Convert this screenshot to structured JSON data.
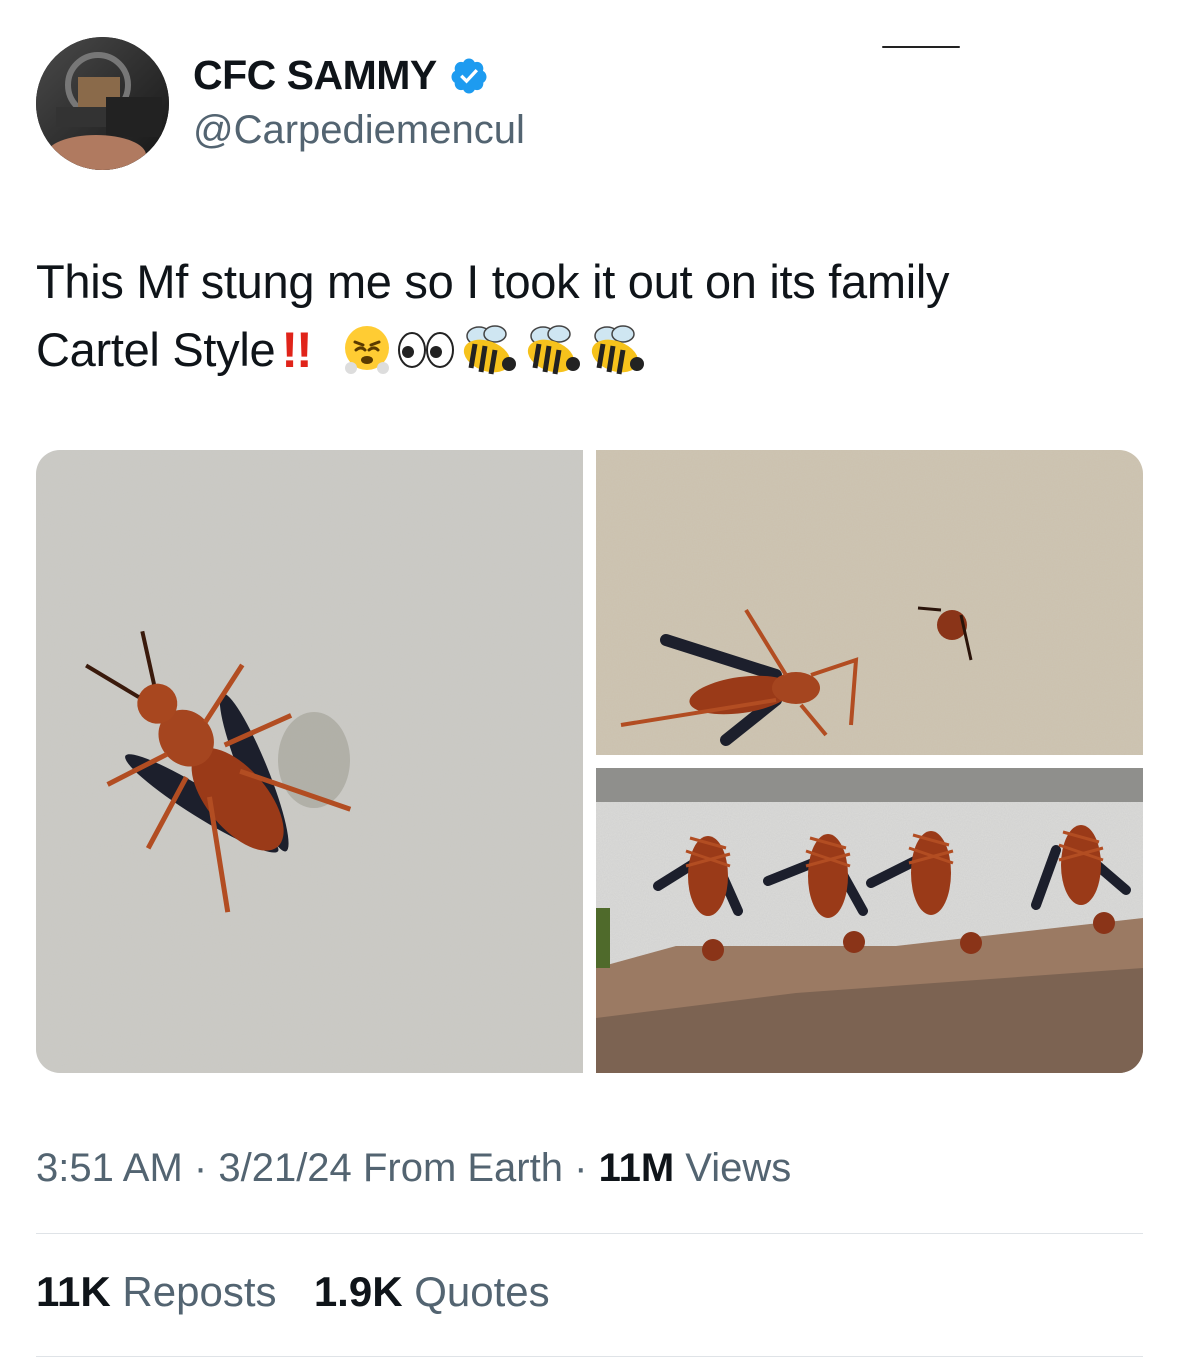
{
  "author": {
    "display_name": "CFC SAMMY",
    "handle": "@Carpediemencul",
    "verified": true
  },
  "tweet": {
    "line1": "This Mf stung me so I took it out on its family",
    "line2": "Cartel Style",
    "exclamation": "!!",
    "emojis": [
      "steam-face-icon",
      "eyes-icon",
      "bee-icon",
      "bee-icon",
      "bee-icon"
    ]
  },
  "media": {
    "photos": [
      {
        "description_icon": "wasp-photo-1"
      },
      {
        "description_icon": "wasp-photo-2"
      },
      {
        "description_icon": "wasp-photo-3"
      }
    ]
  },
  "meta": {
    "time": "3:51 AM",
    "sep1": "·",
    "date": "3/21/24",
    "source": "From Earth",
    "sep2": "·",
    "views_count": "11M",
    "views_label": "Views"
  },
  "stats": {
    "reposts_count": "11K",
    "reposts_label": "Reposts",
    "quotes_count": "1.9K",
    "quotes_label": "Quotes"
  },
  "colors": {
    "verified_blue": "#1d9bf0",
    "secondary_text": "#536471",
    "exclamation_red": "#e0241a"
  }
}
